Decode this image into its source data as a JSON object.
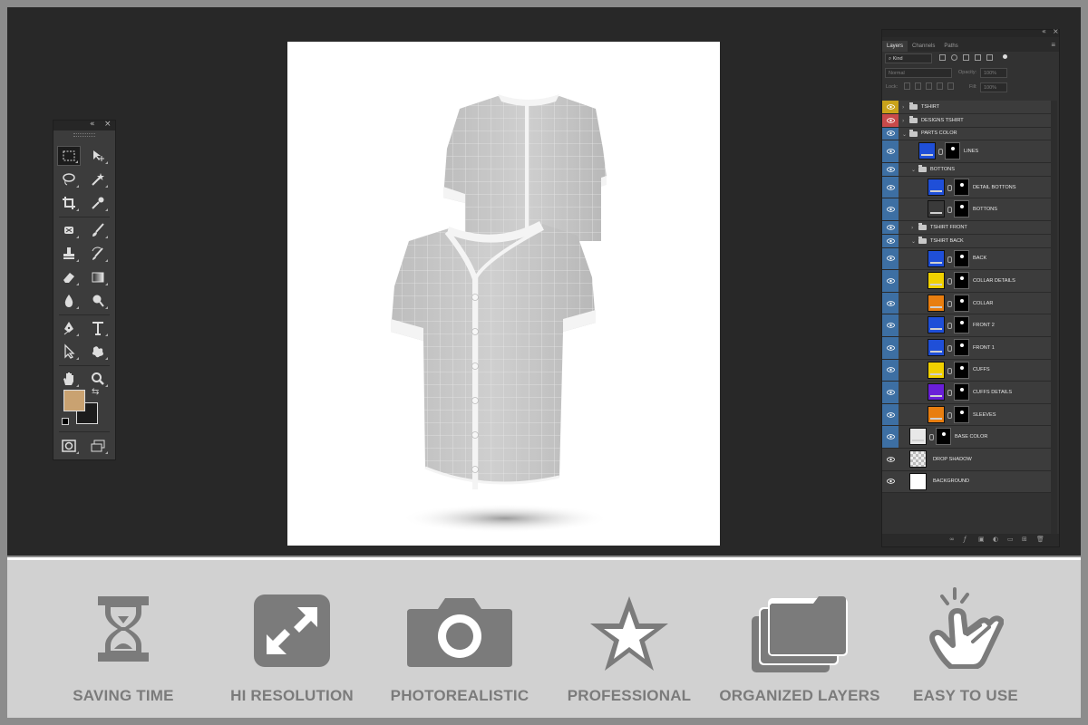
{
  "layers_panel": {
    "tabs": [
      "Layers",
      "Channels",
      "Paths"
    ],
    "filter_kind": "Kind",
    "blend_mode": "Normal",
    "opacity_label": "Opacity:",
    "opacity_value": "100%",
    "lock_label": "Lock:",
    "fill_label": "Fill:",
    "fill_value": "100%",
    "layers": [
      {
        "name": "TSHIRT",
        "kind": "group",
        "indent": 0,
        "eye": "#c9a21a",
        "expanded": false
      },
      {
        "name": "DESIGNS TSHIRT",
        "kind": "group",
        "indent": 0,
        "eye": "#c84a4a",
        "expanded": false
      },
      {
        "name": "PARTS COLOR",
        "kind": "group",
        "indent": 0,
        "eye": "#3d6fa3",
        "expanded": true
      },
      {
        "name": "LINES",
        "kind": "layer",
        "indent": 1,
        "color": "#1f4fd8",
        "eye": "#3d6fa3"
      },
      {
        "name": "BOTTONS",
        "kind": "group",
        "indent": 1,
        "eye": "#3d6fa3",
        "expanded": true
      },
      {
        "name": "DETAIL BOTTONS",
        "kind": "layer",
        "indent": 2,
        "color": "#1f4fd8",
        "eye": "#3d6fa3"
      },
      {
        "name": "BOTTONS",
        "kind": "layer",
        "indent": 2,
        "color": "#3a3a3a",
        "eye": "#3d6fa3"
      },
      {
        "name": "TSHIRT FRONT",
        "kind": "group",
        "indent": 1,
        "eye": "#3d6fa3",
        "expanded": false
      },
      {
        "name": "TSHIRT BACK",
        "kind": "group",
        "indent": 1,
        "eye": "#3d6fa3",
        "expanded": true
      },
      {
        "name": "BACK",
        "kind": "layer",
        "indent": 2,
        "color": "#1f4fd8",
        "eye": "#3d6fa3"
      },
      {
        "name": "COLLAR DETAILS",
        "kind": "layer",
        "indent": 2,
        "color": "#f0d000",
        "eye": "#3d6fa3"
      },
      {
        "name": "COLLAR",
        "kind": "layer",
        "indent": 2,
        "color": "#e87e10",
        "eye": "#3d6fa3"
      },
      {
        "name": "FRONT 2",
        "kind": "layer",
        "indent": 2,
        "color": "#1f4fd8",
        "eye": "#3d6fa3"
      },
      {
        "name": "FRONT 1",
        "kind": "layer",
        "indent": 2,
        "color": "#1f4fd8",
        "eye": "#3d6fa3"
      },
      {
        "name": "CUFFS",
        "kind": "layer",
        "indent": 2,
        "color": "#f0d000",
        "eye": "#3d6fa3"
      },
      {
        "name": "CUFFS DETAILS",
        "kind": "layer",
        "indent": 2,
        "color": "#6a1fd8",
        "eye": "#3d6fa3"
      },
      {
        "name": "SLEEVES",
        "kind": "layer",
        "indent": 2,
        "color": "#e87e10",
        "eye": "#3d6fa3"
      },
      {
        "name": "BASE COLOR",
        "kind": "layer",
        "indent": 0,
        "color": "#e8e8e8",
        "eye": "#3d6fa3"
      },
      {
        "name": "DROP SHADOW",
        "kind": "layer",
        "indent": 0,
        "color": "checker",
        "eye": "plain"
      },
      {
        "name": "BACKGROUND",
        "kind": "layer",
        "indent": 0,
        "color": "#ffffff",
        "eye": "plain"
      }
    ]
  },
  "tools_panel": {
    "foreground_color": "#c9a271",
    "background_color": "#1c1c1c"
  },
  "features": [
    {
      "icon": "hourglass-icon",
      "label": "SAVING TIME"
    },
    {
      "icon": "expand-arrows-icon",
      "label": "HI RESOLUTION"
    },
    {
      "icon": "camera-icon",
      "label": "PHOTOREALISTIC"
    },
    {
      "icon": "star-icon",
      "label": "PROFESSIONAL"
    },
    {
      "icon": "stacked-layers-icon",
      "label": "ORGANIZED LAYERS"
    },
    {
      "icon": "tap-hand-icon",
      "label": "EASY TO USE"
    }
  ]
}
